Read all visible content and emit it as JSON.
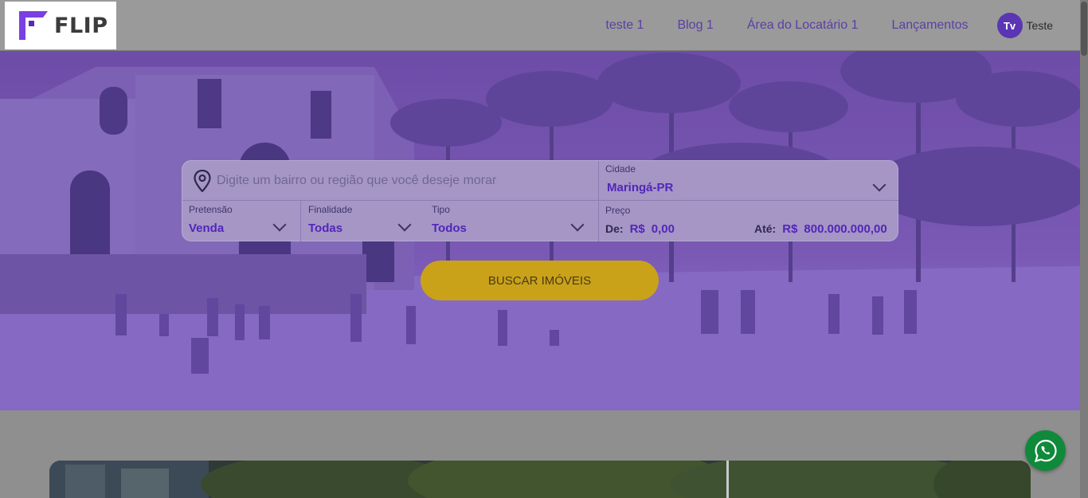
{
  "header": {
    "logo_text": "FLIP",
    "nav": [
      "teste 1",
      "Blog 1",
      "Área do Locatário 1",
      "Lançamentos"
    ],
    "user_initials": "Tv",
    "user_name": "Teste"
  },
  "search": {
    "location_placeholder": "Digite um bairro ou região que você deseje morar",
    "city_label": "Cidade",
    "city_value": "Maringá-PR",
    "pretensao_label": "Pretensão",
    "pretensao_value": "Venda",
    "finalidade_label": "Finalidade",
    "finalidade_value": "Todas",
    "tipo_label": "Tipo",
    "tipo_value": "Todos",
    "preco_label": "Preço",
    "de_label": "De:",
    "de_currency": "R$",
    "de_value": "0,00",
    "ate_label": "Até:",
    "ate_currency": "R$",
    "ate_value": "800.000.000,00",
    "button_label": "BUSCAR IMÓVEIS"
  },
  "colors": {
    "accent": "#5326b8",
    "button": "#c9a21a",
    "whatsapp": "#0f8a3a"
  },
  "icons": [
    "location-pin-icon",
    "chevron-down-icon",
    "whatsapp-icon"
  ]
}
